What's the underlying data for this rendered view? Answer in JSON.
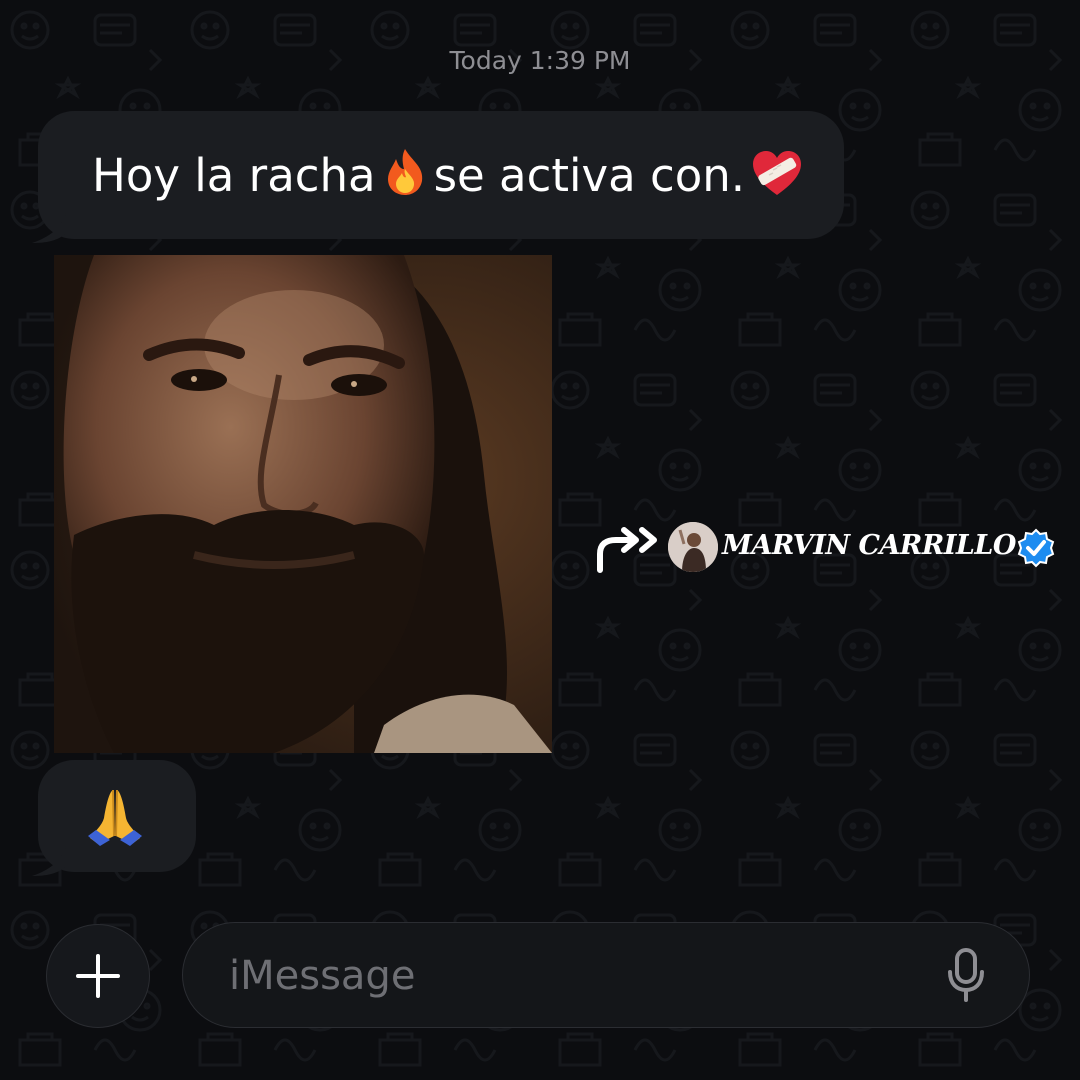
{
  "timestamp": "Today 1:39 PM",
  "messages": {
    "first": {
      "text_before": "Hoy la racha",
      "text_after": "se activa con.",
      "emoji_1": "fire-emoji",
      "emoji_2": "mending-heart-emoji"
    },
    "photo": {
      "description_icon": "man-with-beard-photo"
    },
    "second": {
      "emoji": "praying-hands-emoji"
    }
  },
  "watermark": {
    "name": "MARVIN CARRILLO",
    "arrow_icon": "share-arrow-icon",
    "verified_icon": "verified-badge-icon"
  },
  "composer": {
    "placeholder": "iMessage",
    "plus_icon": "plus-icon",
    "mic_icon": "microphone-icon"
  },
  "colors": {
    "background": "#0c0d10",
    "bubble": "#1b1d21",
    "verified": "#1d8cf0"
  }
}
